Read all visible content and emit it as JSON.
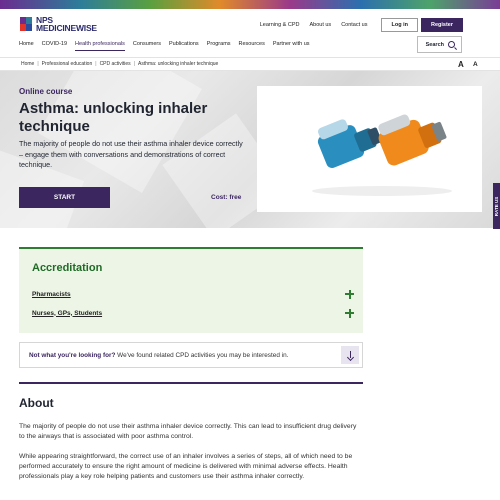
{
  "brand": {
    "line1": "NPS",
    "line2": "MEDICINEWISE"
  },
  "utility_links": [
    "Learning & CPD",
    "About us",
    "Contact us"
  ],
  "auth": {
    "login": "Log in",
    "register": "Register"
  },
  "nav": {
    "items": [
      "Home",
      "COVID-19",
      "Health professionals",
      "Consumers",
      "Publications",
      "Programs",
      "Resources",
      "Partner with us"
    ],
    "active": "Health professionals"
  },
  "search": {
    "label": "Search"
  },
  "breadcrumb": [
    "Home",
    "Professional education",
    "CPD activities",
    "Asthma: unlocking inhaler technique"
  ],
  "text_size": {
    "large": "A",
    "small": "A"
  },
  "hero": {
    "type": "Online course",
    "title": "Asthma: unlocking inhaler technique",
    "description": "The majority of people do not use their asthma inhaler device correctly – engage them with conversations and demonstrations of correct technique.",
    "start_label": "START",
    "cost": "Cost: free"
  },
  "rate_us": "RATE US",
  "accreditation": {
    "title": "Accreditation",
    "items": [
      "Pharmacists",
      "Nurses, GPs, Students"
    ]
  },
  "not_looking": {
    "bold": "Not what you're looking for?",
    "text": " We've found related CPD activities you may be interested in."
  },
  "about": {
    "title": "About",
    "paragraphs": [
      "The majority of people do not use their asthma inhaler device correctly. This can lead to insufficient drug delivery to the airways that is associated with poor asthma control.",
      "While appearing straightforward, the correct use of an inhaler involves a series of steps, all of which need to be performed accurately to ensure the right amount of medicine is delivered with minimal adverse effects. Health professionals play a key role helping patients and customers use their asthma inhaler correctly."
    ]
  },
  "colors": {
    "brand_purple": "#3b2660",
    "accreditation_green": "#2e7d32",
    "inhaler_blue": "#2a8fbf",
    "inhaler_orange": "#f08a1c"
  }
}
